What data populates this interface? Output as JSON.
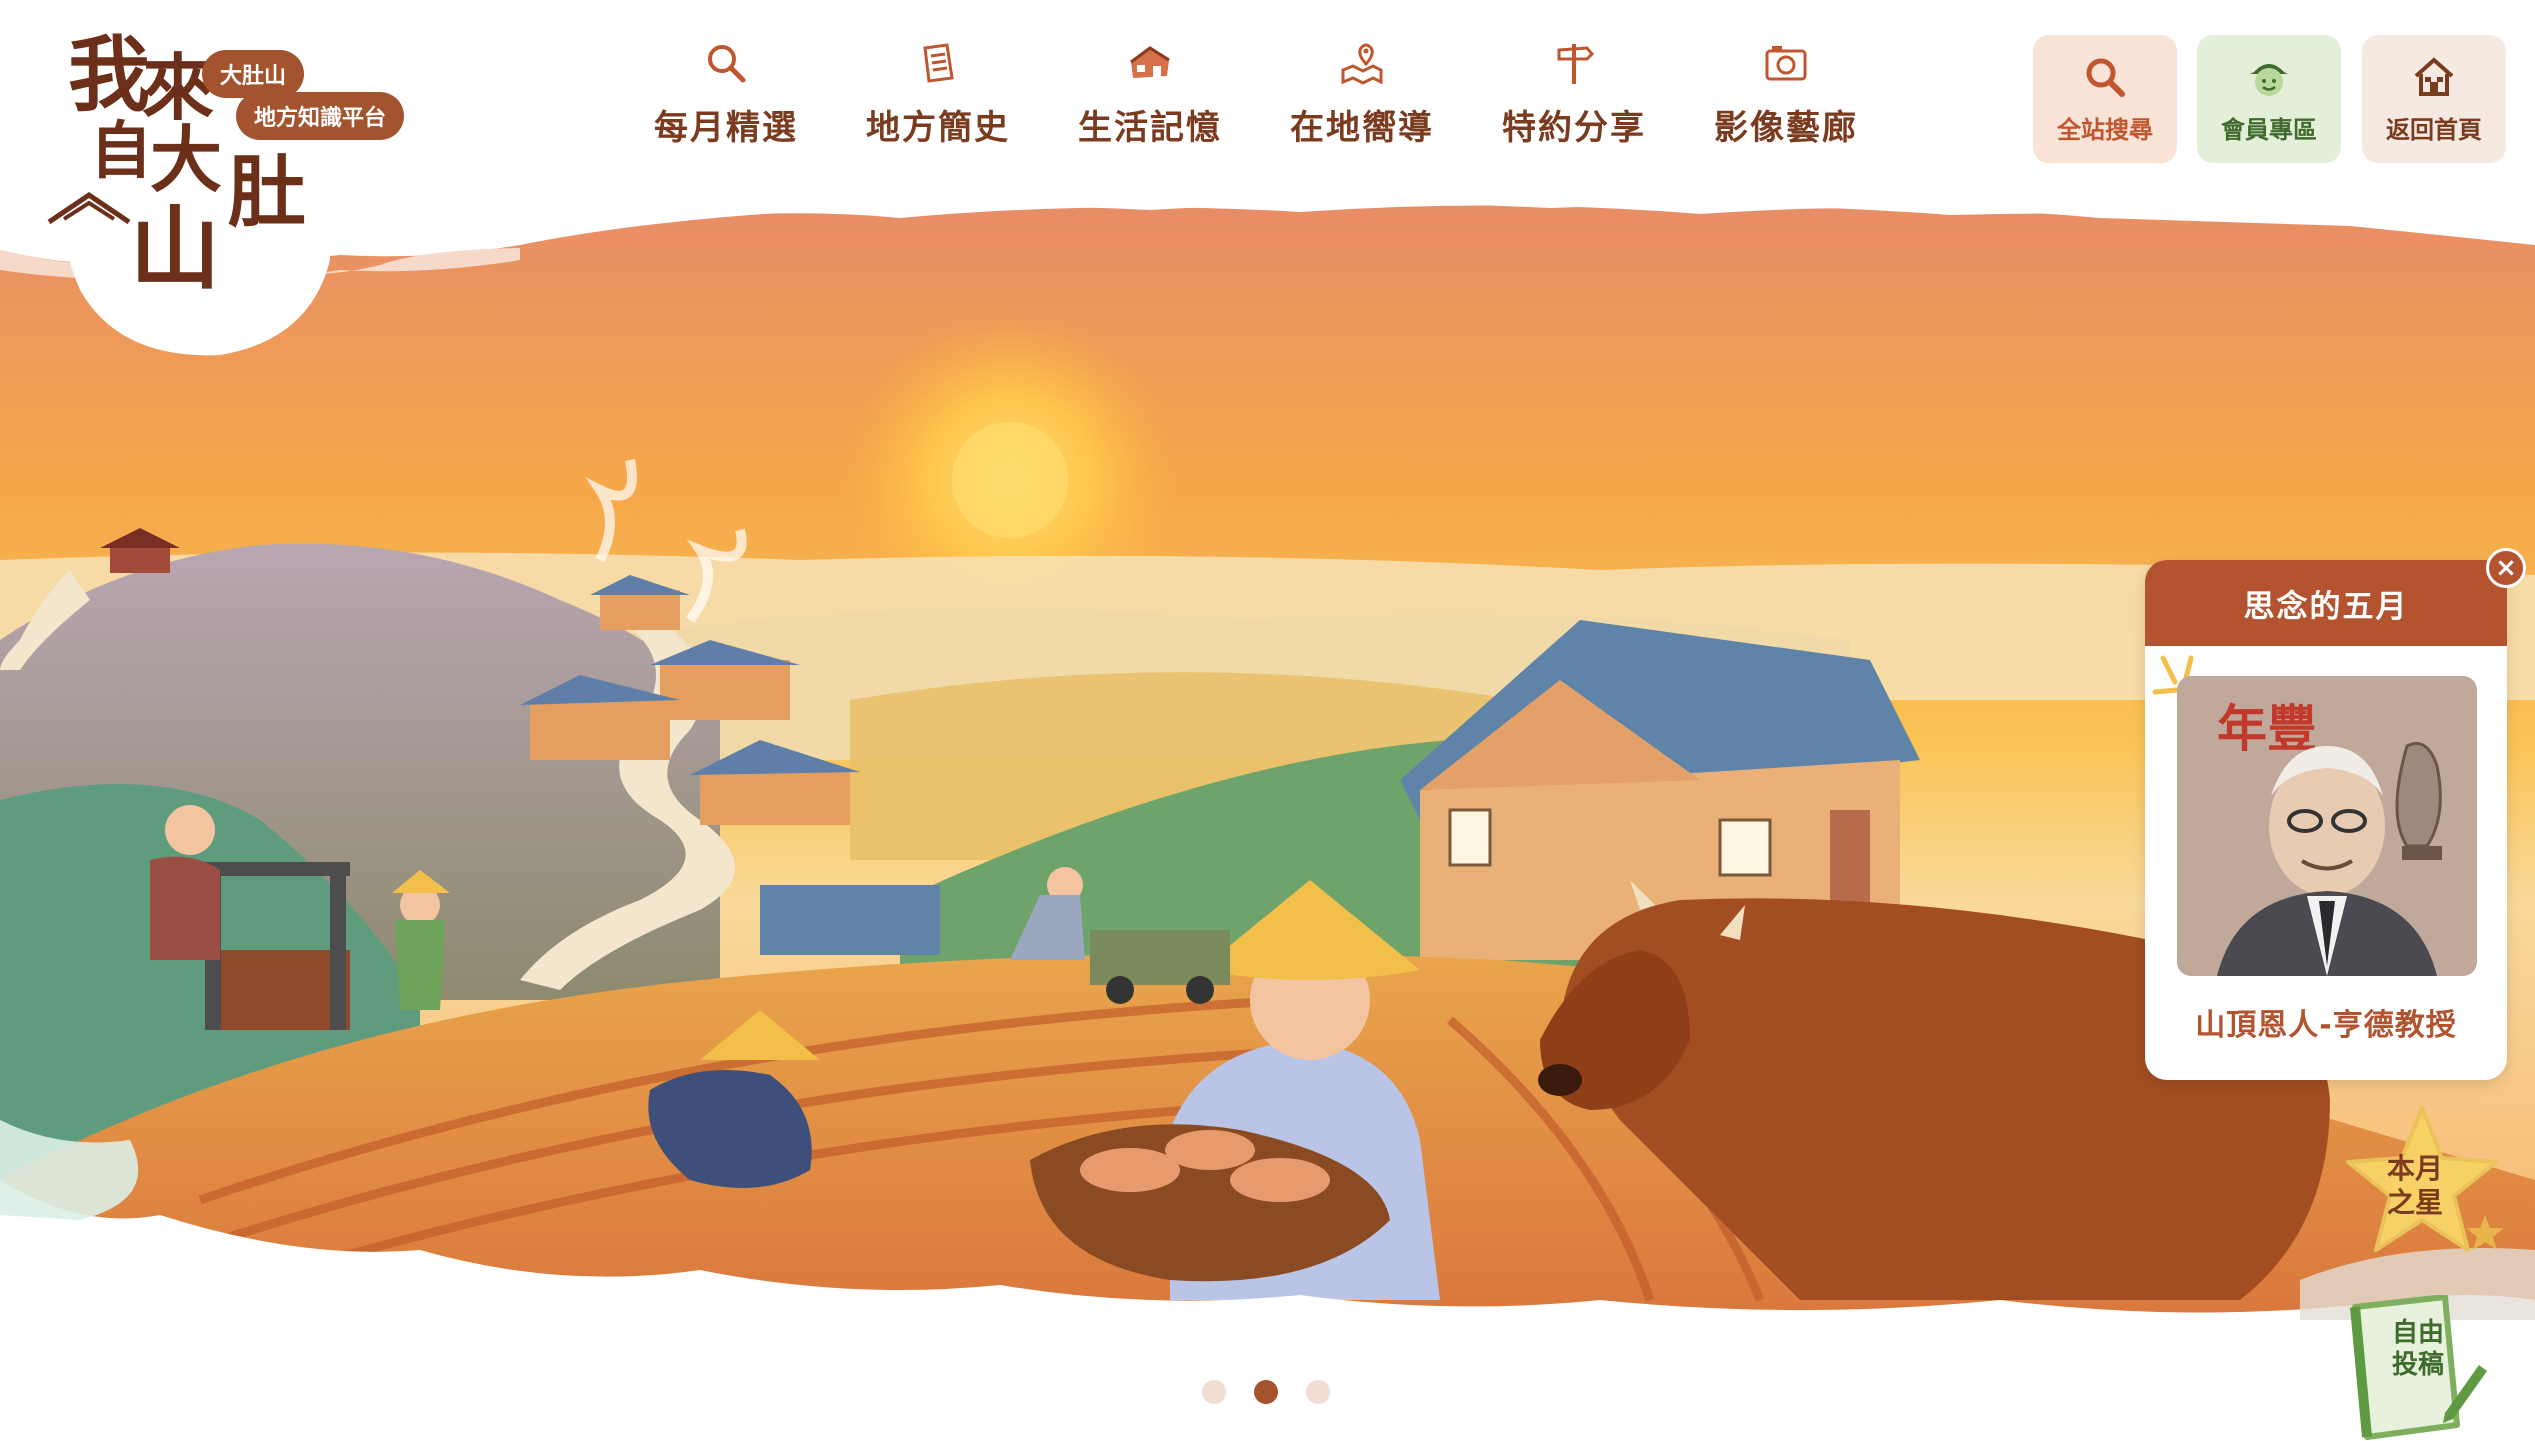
{
  "logo": {
    "chars": [
      "我",
      "來",
      "自",
      "大",
      "肚",
      "山"
    ],
    "tag_line1": "大肚山",
    "tag_line2": "地方知識平台"
  },
  "nav": [
    {
      "label": "每月精選",
      "icon": "search-icon"
    },
    {
      "label": "地方簡史",
      "icon": "document-icon"
    },
    {
      "label": "生活記憶",
      "icon": "house-icon"
    },
    {
      "label": "在地嚮導",
      "icon": "map-pin-icon"
    },
    {
      "label": "特約分享",
      "icon": "signpost-icon"
    },
    {
      "label": "影像藝廊",
      "icon": "camera-icon"
    }
  ],
  "utility": {
    "search": {
      "label": "全站搜尋",
      "icon": "search-icon",
      "color": "#f8e3d6"
    },
    "member": {
      "label": "會員專區",
      "icon": "member-face-icon",
      "color": "#e3efd9"
    },
    "home": {
      "label": "返回首頁",
      "icon": "home-icon",
      "color": "#f5e9e2"
    }
  },
  "popup": {
    "title": "思念的五月",
    "close": "×",
    "image_label": "年豐",
    "caption": "山頂恩人-亨德教授"
  },
  "star_badge": {
    "line1": "本月",
    "line2": "之星"
  },
  "submit": {
    "line1": "自由",
    "line2": "投稿"
  },
  "carousel": {
    "count": 3,
    "active_index": 1
  },
  "colors": {
    "brand_brown": "#7a3b1f",
    "accent_rust": "#b3532f",
    "search_bg": "#f8e3d6",
    "member_bg": "#e3efd9",
    "home_bg": "#f5e9e2"
  }
}
